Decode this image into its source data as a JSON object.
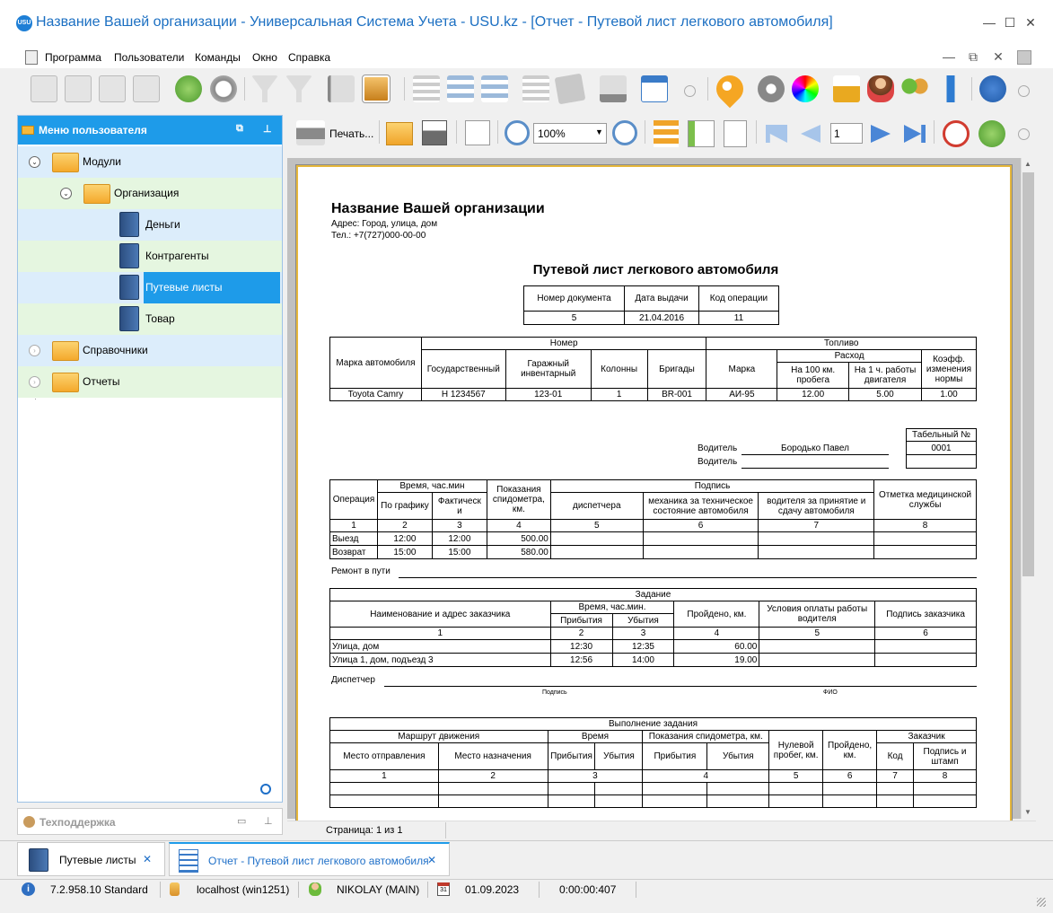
{
  "window": {
    "title": "Название Вашей организации - Универсальная Система Учета - USU.kz - [Отчет - Путевой лист легкового автомобиля]",
    "logo": "USU",
    "controls": [
      "—",
      "☐",
      "✕"
    ],
    "mdi_controls": [
      "—",
      "⧉",
      "✕"
    ]
  },
  "menu": [
    "Программа",
    "Пользователи",
    "Команды",
    "Окно",
    "Справка"
  ],
  "sidebar": {
    "title": "Меню пользователя",
    "items": [
      {
        "label": "Модули"
      },
      {
        "label": "Организация"
      },
      {
        "label": "Деньги"
      },
      {
        "label": "Контрагенты"
      },
      {
        "label": "Путевые листы"
      },
      {
        "label": "Товар"
      },
      {
        "label": "Справочники"
      },
      {
        "label": "Отчеты"
      }
    ],
    "support": "Техподдержка"
  },
  "report_toolbar": {
    "print_label": "Печать...",
    "zoom": "100%",
    "page_number": "1"
  },
  "report": {
    "org_name": "Название Вашей организации",
    "address": "Адрес: Город, улица, дом",
    "phone": "Тел.: +7(727)000-00-00",
    "doc_title": "Путевой лист легкового автомобиля",
    "doc_header": {
      "headers": [
        "Номер документа",
        "Дата выдачи",
        "Код операции"
      ],
      "values": [
        "5",
        "21.04.2016",
        "11"
      ]
    },
    "car": {
      "h_brand": "Марка автомобиля",
      "h_number": "Номер",
      "h_fuel": "Топливо",
      "h_state": "Государственный",
      "h_garage": "Гаражный инвентарный",
      "h_column": "Колонны",
      "h_brigade": "Бригады",
      "h_fuel_brand": "Марка",
      "h_consumption": "Расход",
      "h_per100": "На 100 км. пробега",
      "h_perhour": "На 1 ч. работы двигателя",
      "h_coef": "Коэфф. изменения нормы",
      "row": [
        "Toyota Camry",
        "Н 1234567",
        "123-01",
        "1",
        "BR-001",
        "АИ-95",
        "12.00",
        "5.00",
        "1.00"
      ]
    },
    "driver": {
      "tabel_label": "Табельный №",
      "tabel_value": "0001",
      "driver_label": "Водитель",
      "driver_name": "Бородько Павел",
      "driver_label2": "Водитель"
    },
    "ops": {
      "h_operation": "Операция",
      "h_time": "Время, час.мин",
      "h_schedule": "По графику",
      "h_actual": "Фактическ и",
      "h_speedo": "Показания спидометра, км.",
      "h_signature": "Подпись",
      "h_dispatcher": "диспетчера",
      "h_mechanic": "механика за техническое состояние автомобиля",
      "h_driver": "водителя за принятие и сдачу автомобиля",
      "h_medical": "Отметка медицинской службы",
      "nums": [
        "1",
        "2",
        "3",
        "4",
        "5",
        "6",
        "7",
        "8"
      ],
      "rows": [
        [
          "Выезд",
          "12:00",
          "12:00",
          "500.00"
        ],
        [
          "Возврат",
          "15:00",
          "15:00",
          "580.00"
        ]
      ]
    },
    "repair_label": "Ремонт в пути",
    "task": {
      "title": "Задание",
      "h_customer": "Наименование и адрес заказчика",
      "h_time": "Время, час.мин.",
      "h_arrival": "Прибытия",
      "h_departure": "Убытия",
      "h_distance": "Пройдено, км.",
      "h_payment": "Условия оплаты работы водителя",
      "h_sign": "Подпись заказчика",
      "nums": [
        "1",
        "2",
        "3",
        "4",
        "5",
        "6"
      ],
      "rows": [
        [
          "Улица, дом",
          "12:30",
          "12:35",
          "60.00"
        ],
        [
          "Улица 1, дом, подъезд 3",
          "12:56",
          "14:00",
          "19.00"
        ]
      ]
    },
    "dispatcher_label": "Диспетчер",
    "signature_caption": "Подпись",
    "fio_caption": "ФИО",
    "execution": {
      "title": "Выполнение задания",
      "h_route": "Маршрут движения",
      "h_time": "Время",
      "h_speedo": "Показания спидометра, км.",
      "h_zero_run": "Нулевой пробег, км.",
      "h_passed": "Пройдено, км.",
      "h_customer": "Заказчик",
      "h_from": "Место отправления",
      "h_to": "Место назначения",
      "h_arrival": "Прибытия",
      "h_departure": "Убытия",
      "h_arrival2": "Прибытия",
      "h_departure2": "Убытия",
      "h_code": "Код",
      "h_sign": "Подпись и штамп",
      "nums": [
        "1",
        "2",
        "3",
        "4",
        "5",
        "6",
        "7",
        "8"
      ]
    }
  },
  "page_status": "Страница: 1 из 1",
  "tabs": [
    {
      "label": "Путевые листы",
      "close": "✕"
    },
    {
      "label": "Отчет - Путевой лист легкового автомобиля",
      "close": "✕"
    }
  ],
  "status": {
    "version": "7.2.958.10 Standard",
    "host": "localhost (win1251)",
    "user": "NIKOLAY (MAIN)",
    "date": "01.09.2023",
    "timer": "0:00:00:407",
    "calendar_day": "31"
  },
  "colors": {
    "accent": "#1e9be9",
    "title_text": "#1b6fc2",
    "selected": "#1e9be9",
    "row_blue": "#dcedfb",
    "row_green": "#e5f6e0",
    "page_border": "#e5b73b"
  }
}
